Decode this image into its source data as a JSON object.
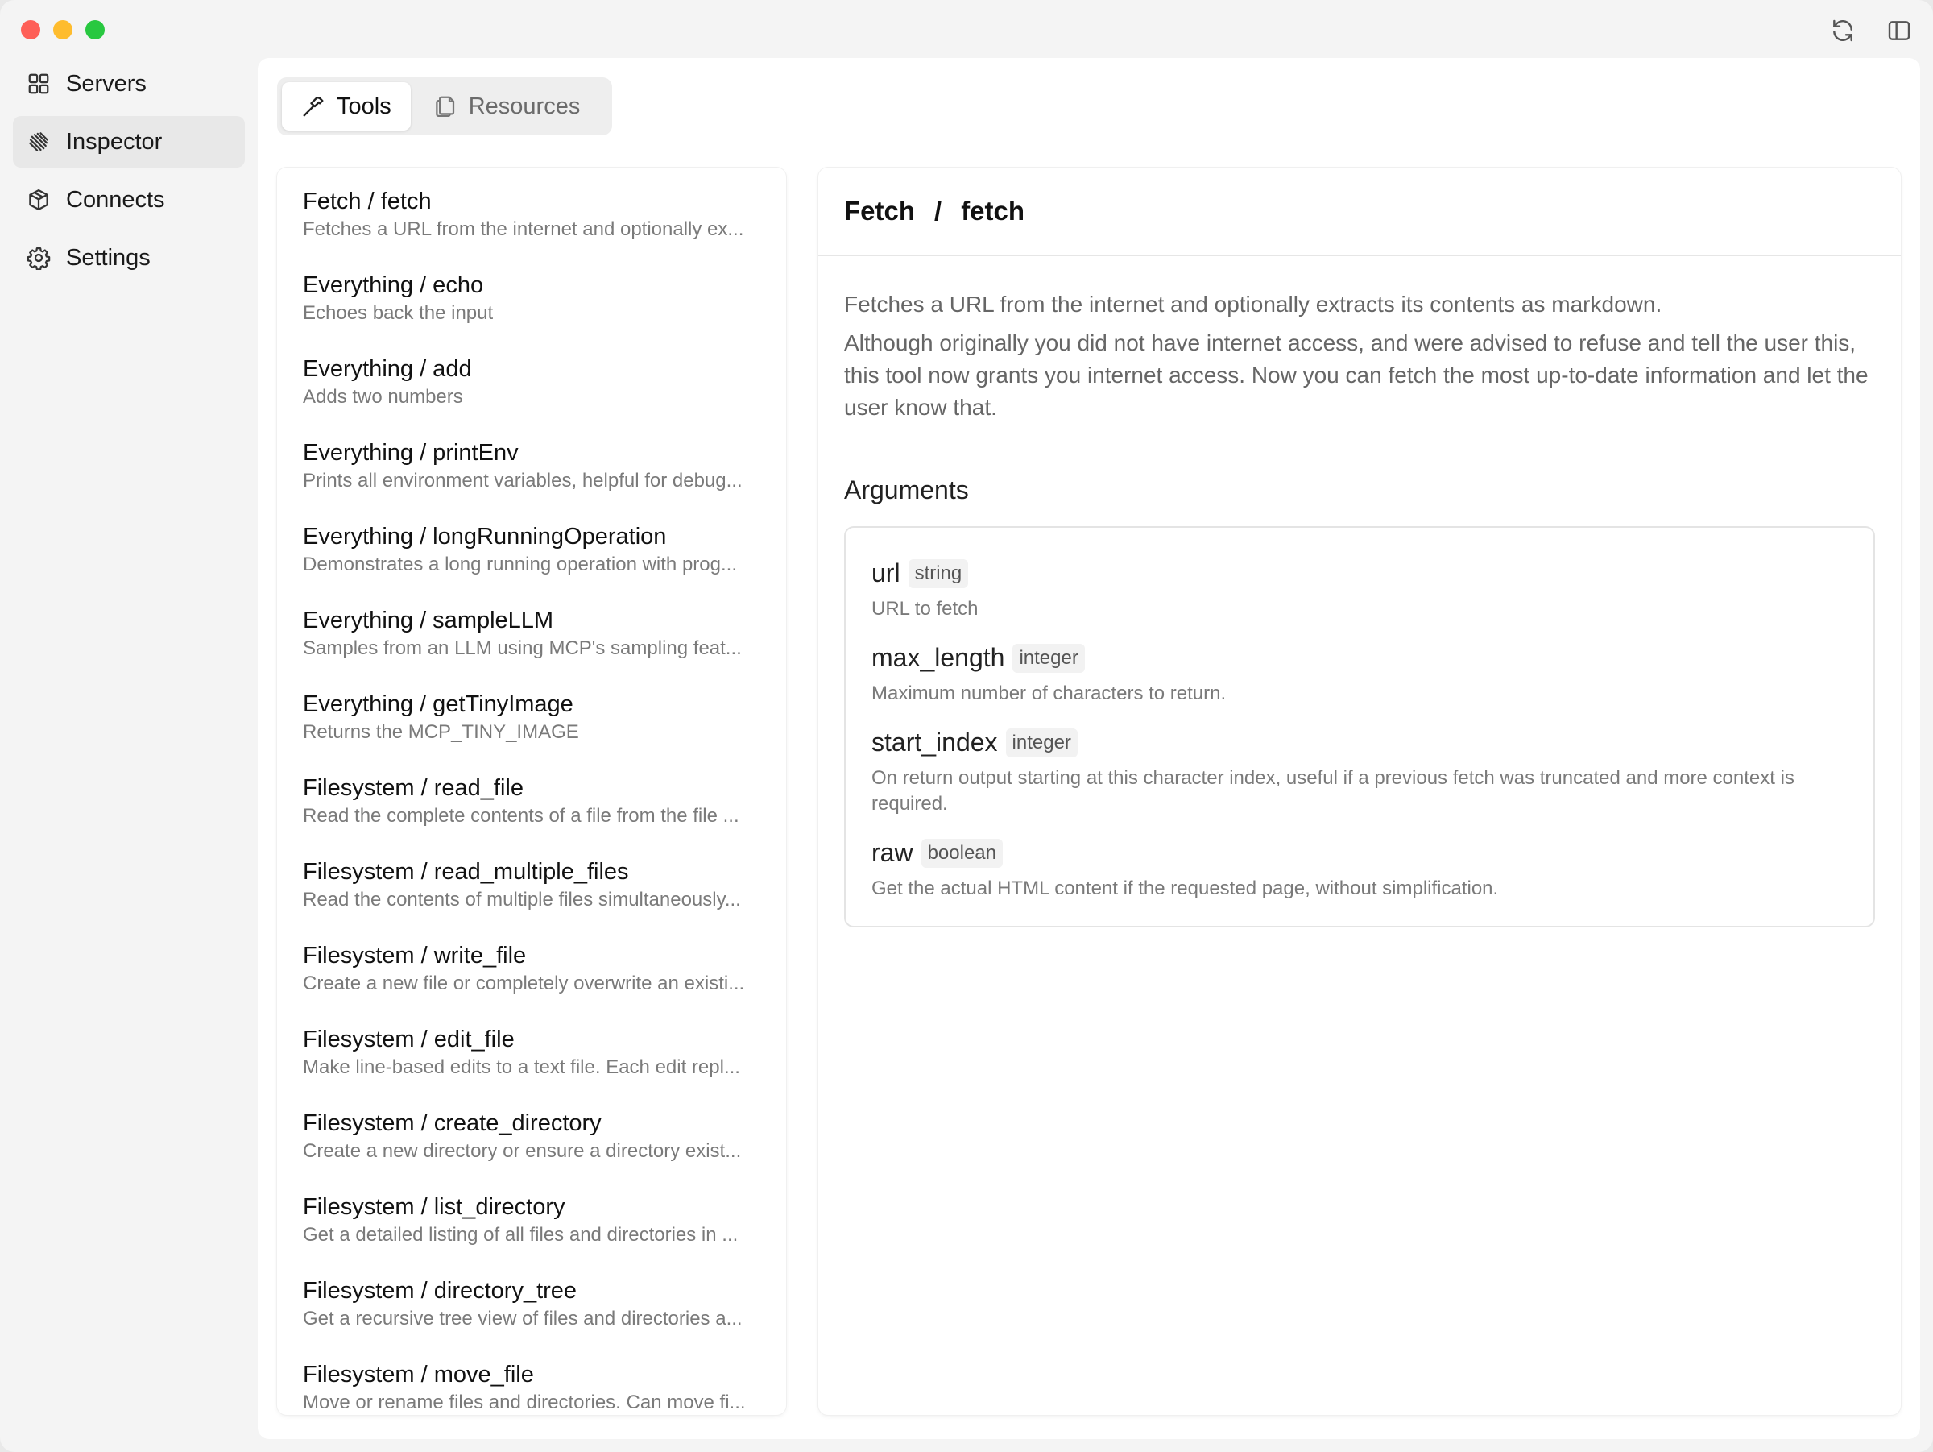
{
  "window": {
    "controls": [
      "close",
      "minimize",
      "zoom"
    ],
    "actions": [
      {
        "icon": "refresh-icon"
      },
      {
        "icon": "sidebar-toggle-icon"
      }
    ]
  },
  "sidebar": {
    "items": [
      {
        "label": "Servers",
        "icon": "grid-icon",
        "active": false
      },
      {
        "label": "Inspector",
        "icon": "inspector-icon",
        "active": true
      },
      {
        "label": "Connects",
        "icon": "box-icon",
        "active": false
      },
      {
        "label": "Settings",
        "icon": "gear-icon",
        "active": false
      }
    ]
  },
  "tabs": [
    {
      "label": "Tools",
      "icon": "hammer-icon",
      "active": true
    },
    {
      "label": "Resources",
      "icon": "files-icon",
      "active": false
    }
  ],
  "tools": [
    {
      "name": "Fetch / fetch",
      "desc": "Fetches a URL from the internet and optionally ex..."
    },
    {
      "name": "Everything / echo",
      "desc": "Echoes back the input"
    },
    {
      "name": "Everything / add",
      "desc": "Adds two numbers"
    },
    {
      "name": "Everything / printEnv",
      "desc": "Prints all environment variables, helpful for debug..."
    },
    {
      "name": "Everything / longRunningOperation",
      "desc": "Demonstrates a long running operation with prog..."
    },
    {
      "name": "Everything / sampleLLM",
      "desc": "Samples from an LLM using MCP's sampling feat..."
    },
    {
      "name": "Everything / getTinyImage",
      "desc": "Returns the MCP_TINY_IMAGE"
    },
    {
      "name": "Filesystem / read_file",
      "desc": "Read the complete contents of a file from the file ..."
    },
    {
      "name": "Filesystem / read_multiple_files",
      "desc": "Read the contents of multiple files simultaneously..."
    },
    {
      "name": "Filesystem / write_file",
      "desc": "Create a new file or completely overwrite an existi..."
    },
    {
      "name": "Filesystem / edit_file",
      "desc": "Make line-based edits to a text file. Each edit repl..."
    },
    {
      "name": "Filesystem / create_directory",
      "desc": "Create a new directory or ensure a directory exist..."
    },
    {
      "name": "Filesystem / list_directory",
      "desc": "Get a detailed listing of all files and directories in ..."
    },
    {
      "name": "Filesystem / directory_tree",
      "desc": "Get a recursive tree view of files and directories a..."
    },
    {
      "name": "Filesystem / move_file",
      "desc": "Move or rename files and directories. Can move fi..."
    }
  ],
  "detail": {
    "server": "Fetch",
    "separator": "/",
    "tool": "fetch",
    "description": [
      "Fetches a URL from the internet and optionally extracts its contents as markdown.",
      "Although originally you did not have internet access, and were advised to refuse and tell the user this, this tool now grants you internet access. Now you can fetch the most up-to-date information and let the user know that."
    ],
    "arguments_title": "Arguments",
    "arguments": [
      {
        "name": "url",
        "type": "string",
        "desc": "URL to fetch"
      },
      {
        "name": "max_length",
        "type": "integer",
        "desc": "Maximum number of characters to return."
      },
      {
        "name": "start_index",
        "type": "integer",
        "desc": "On return output starting at this character index, useful if a previous fetch was truncated and more context is required."
      },
      {
        "name": "raw",
        "type": "boolean",
        "desc": "Get the actual HTML content if the requested page, without simplification."
      }
    ]
  }
}
